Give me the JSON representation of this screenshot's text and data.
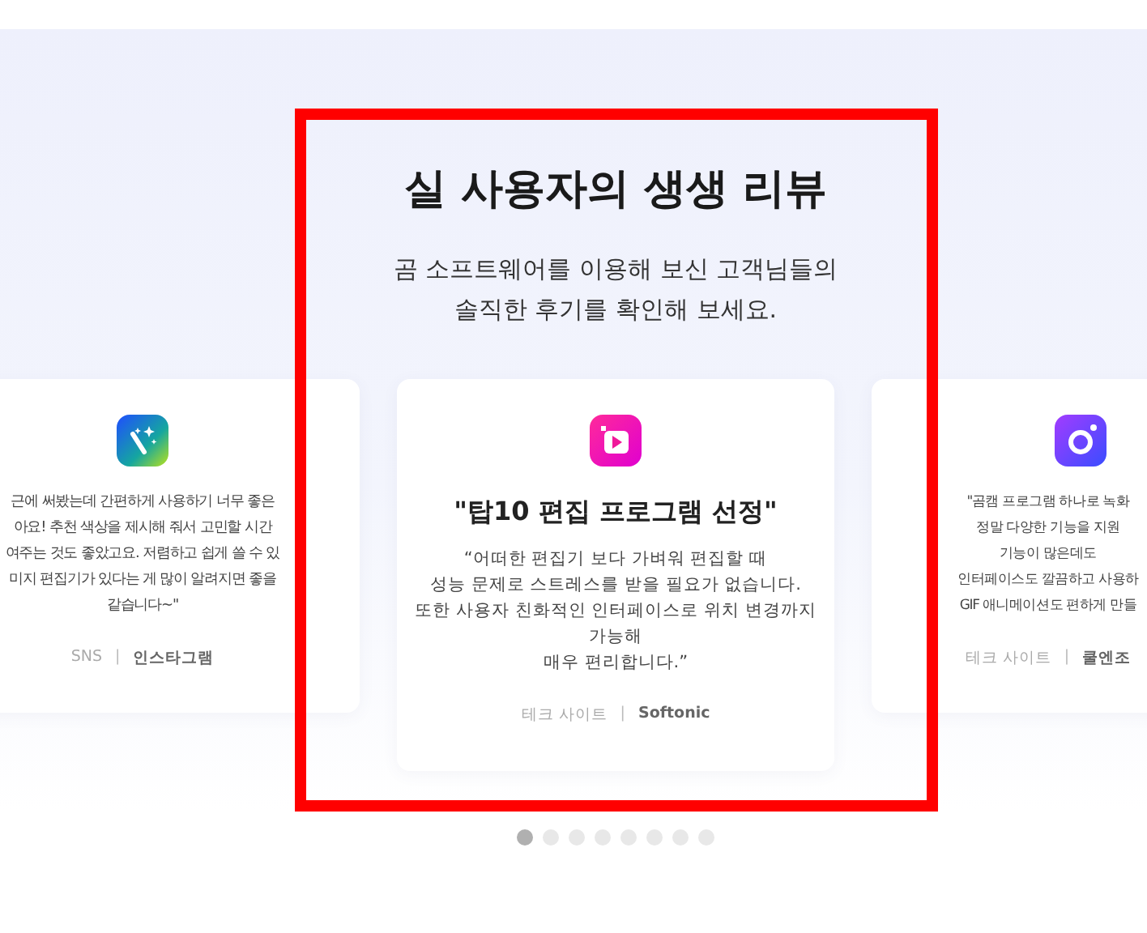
{
  "heading": "실 사용자의 생생 리뷰",
  "subheading_lines": [
    "곰 소프트웨어를 이용해 보신 고객님들의",
    "솔직한 후기를 확인해 보세요."
  ],
  "reviews": [
    {
      "kind": "wand",
      "lines": [
        "근에 써봤는데 간편하게 사용하기 너무 좋은",
        "아요! 추천 색상을 제시해 줘서 고민할 시간",
        "여주는 것도 좋았고요. 저렴하고 쉽게 쓸 수 있",
        "미지 편집기가 있다는 게 많이 알려지면 좋을",
        "같습니다~\""
      ],
      "source_type": "SNS",
      "separator": "|",
      "source_name": "인스타그램"
    },
    {
      "kind": "play",
      "title": "\"탑10 편집 프로그램 선정\"",
      "lines": [
        "“어떠한 편집기 보다 가벼워 편집할 때",
        "성능 문제로 스트레스를 받을 필요가 없습니다.",
        "또한 사용자 친화적인 인터페이스로 위치 변경까지",
        "가능해",
        "매우 편리합니다.”"
      ],
      "source_type": "테크 사이트",
      "separator": "|",
      "source_name": "Softonic"
    },
    {
      "kind": "camera",
      "lines": [
        "\"곰캠 프로그램 하나로 녹화",
        "정말 다양한 기능을 지원",
        "기능이 많은데도",
        "인터페이스도 깔끔하고 사용하",
        "GIF 애니메이션도 편하게 만들"
      ],
      "source_type": "테크 사이트",
      "separator": "|",
      "source_name": "쿨엔조"
    }
  ],
  "pager": [
    {
      "selected": true
    },
    {
      "selected": false
    },
    {
      "selected": false
    },
    {
      "selected": false
    },
    {
      "selected": false
    },
    {
      "selected": false
    },
    {
      "selected": false
    },
    {
      "selected": false
    }
  ]
}
